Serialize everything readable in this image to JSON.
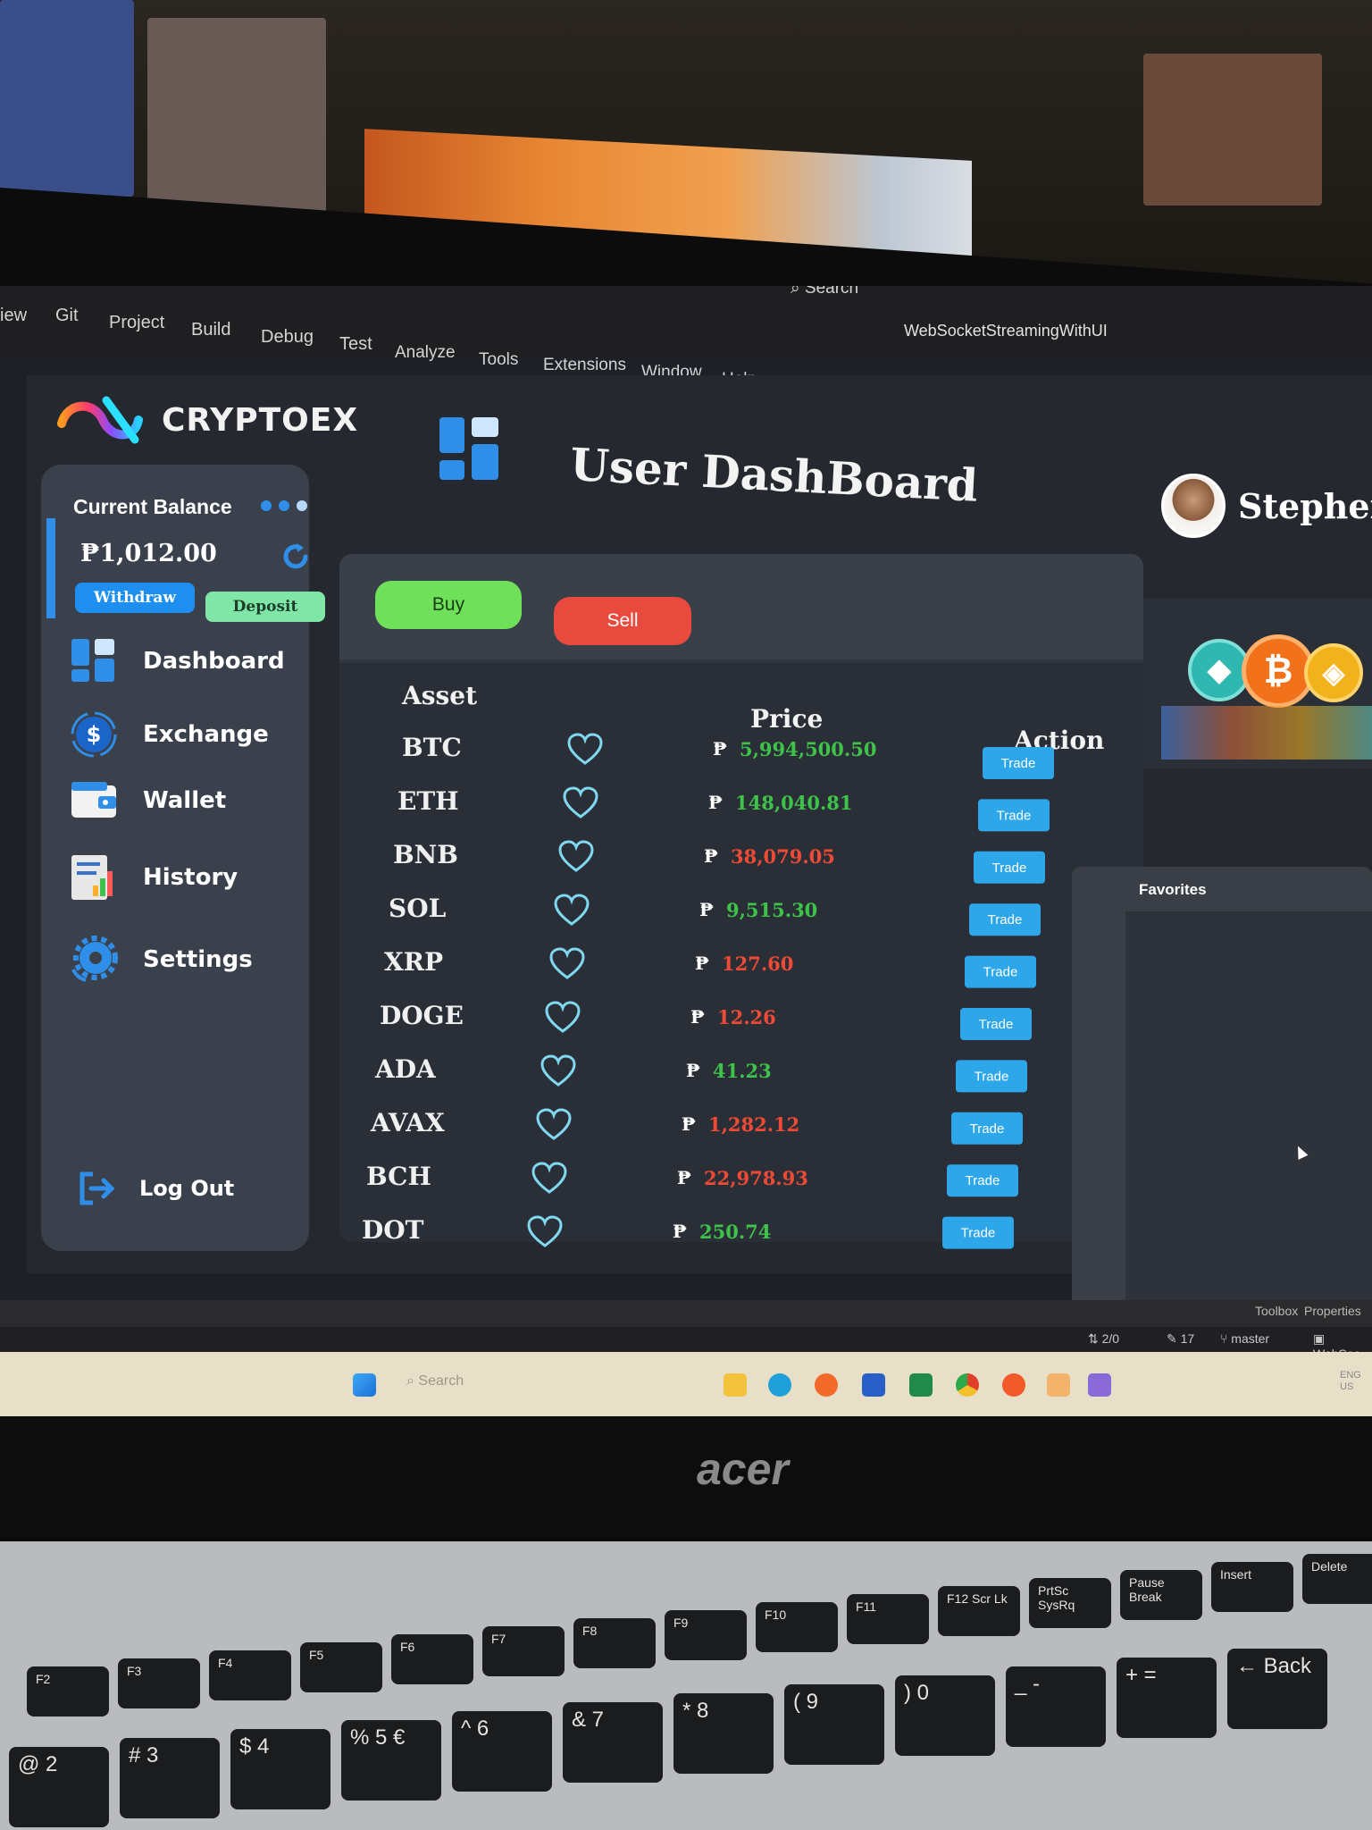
{
  "vs_menu": [
    "iew",
    "Git",
    "Project",
    "Build",
    "Debug",
    "Test",
    "Analyze",
    "Tools",
    "Extensions",
    "Window",
    "Help"
  ],
  "vs_search": "Search",
  "vs_title": "WebSocketStreamingWithUI",
  "brand": {
    "name": "CRYPTOEX"
  },
  "sidebar": {
    "balance_title": "Current Balance",
    "balance_amount": "₱1,012.00",
    "withdraw_label": "Withdraw",
    "deposit_label": "Deposit",
    "items": [
      {
        "label": "Dashboard",
        "icon": "dashboard-icon"
      },
      {
        "label": "Exchange",
        "icon": "exchange-icon"
      },
      {
        "label": "Wallet",
        "icon": "wallet-icon"
      },
      {
        "label": "History",
        "icon": "history-icon"
      },
      {
        "label": "Settings",
        "icon": "settings-icon"
      }
    ],
    "logout_label": "Log Out"
  },
  "header": {
    "title": "User DashBoard",
    "user_name": "Stephen"
  },
  "trade": {
    "buy_label": "Buy",
    "sell_label": "Sell"
  },
  "table": {
    "columns": {
      "asset": "Asset",
      "price": "Price",
      "action": "Action"
    },
    "currency_symbol": "₱",
    "rows": [
      {
        "asset": "BTC",
        "price": "5,994,500.50",
        "trend": "up",
        "action": "Trade"
      },
      {
        "asset": "ETH",
        "price": "148,040.81",
        "trend": "up",
        "action": "Trade"
      },
      {
        "asset": "BNB",
        "price": "38,079.05",
        "trend": "down",
        "action": "Trade"
      },
      {
        "asset": "SOL",
        "price": "9,515.30",
        "trend": "up",
        "action": "Trade"
      },
      {
        "asset": "XRP",
        "price": "127.60",
        "trend": "down",
        "action": "Trade"
      },
      {
        "asset": "DOGE",
        "price": "12.26",
        "trend": "down",
        "action": "Trade"
      },
      {
        "asset": "ADA",
        "price": "41.23",
        "trend": "up",
        "action": "Trade"
      },
      {
        "asset": "AVAX",
        "price": "1,282.12",
        "trend": "down",
        "action": "Trade"
      },
      {
        "asset": "BCH",
        "price": "22,978.93",
        "trend": "down",
        "action": "Trade"
      },
      {
        "asset": "DOT",
        "price": "250.74",
        "trend": "up",
        "action": "Trade"
      }
    ]
  },
  "favorites": {
    "title": "Favorites"
  },
  "colors": {
    "up": "#3ec24a",
    "down": "#ee4a35",
    "accent": "#2f8fe8",
    "buy": "#6ee05a",
    "sell": "#e84a3e"
  },
  "vs_bottom": {
    "toolbox": "Toolbox",
    "properties": "Properties"
  },
  "vs_status": {
    "lines": "2/0",
    "changes": "17",
    "branch": "master",
    "project": "WebSoc"
  },
  "taskbar": {
    "search_placeholder": "Search",
    "lang": "ENG",
    "region": "US"
  },
  "laptop_brand": "acer",
  "keyboard": {
    "fn_keys": [
      "F2",
      "F3",
      "F4",
      "F5",
      "F6",
      "F7",
      "F8",
      "F9",
      "F10",
      "F11",
      "F12 Scr Lk",
      "PrtSc SysRq",
      "Pause Break",
      "Insert",
      "Delete"
    ],
    "number_keys": [
      "@ 2",
      "# 3",
      "$ 4",
      "% 5 €",
      "^ 6",
      "& 7",
      "* 8",
      "( 9",
      ") 0",
      "_ -",
      "+ =",
      "← Back"
    ]
  }
}
